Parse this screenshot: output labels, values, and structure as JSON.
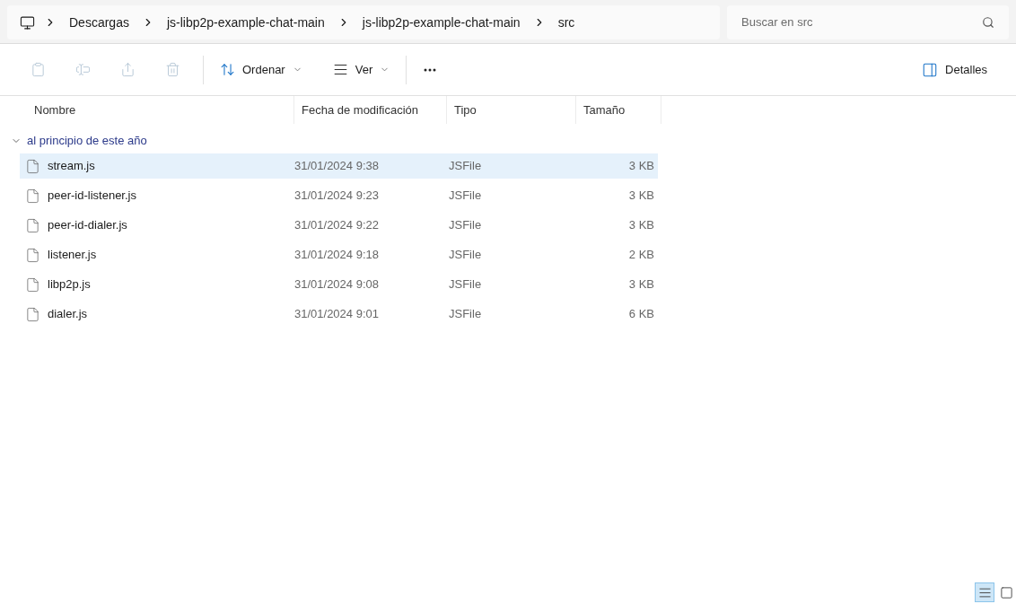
{
  "breadcrumb": [
    "Descargas",
    "js-libp2p-example-chat-main",
    "js-libp2p-example-chat-main",
    "src"
  ],
  "search": {
    "placeholder": "Buscar en src"
  },
  "toolbar": {
    "actions": [
      {
        "kind": "paste",
        "disabled": true
      },
      {
        "kind": "rename",
        "disabled": true
      },
      {
        "kind": "share",
        "disabled": true
      },
      {
        "kind": "delete",
        "disabled": true
      }
    ],
    "sort": "Ordenar",
    "view": "Ver",
    "details": "Detalles"
  },
  "columns": [
    "Nombre",
    "Fecha de modificación",
    "Tipo",
    "Tamaño"
  ],
  "group": {
    "label": "al principio de este año",
    "expanded": true
  },
  "rows": [
    {
      "name": "stream.js",
      "date": "31/01/2024 9:38",
      "type": "JSFile",
      "size": "3 KB",
      "selected": true
    },
    {
      "name": "peer-id-listener.js",
      "date": "31/01/2024 9:23",
      "type": "JSFile",
      "size": "3 KB",
      "selected": false
    },
    {
      "name": "peer-id-dialer.js",
      "date": "31/01/2024 9:22",
      "type": "JSFile",
      "size": "3 KB",
      "selected": false
    },
    {
      "name": "listener.js",
      "date": "31/01/2024 9:18",
      "type": "JSFile",
      "size": "2 KB",
      "selected": false
    },
    {
      "name": "libp2p.js",
      "date": "31/01/2024 9:08",
      "type": "JSFile",
      "size": "3 KB",
      "selected": false
    },
    {
      "name": "dialer.js",
      "date": "31/01/2024 9:01",
      "type": "JSFile",
      "size": "6 KB",
      "selected": false
    }
  ],
  "view_modes": [
    {
      "kind": "details",
      "selected": true
    },
    {
      "kind": "tiles",
      "selected": false
    }
  ]
}
